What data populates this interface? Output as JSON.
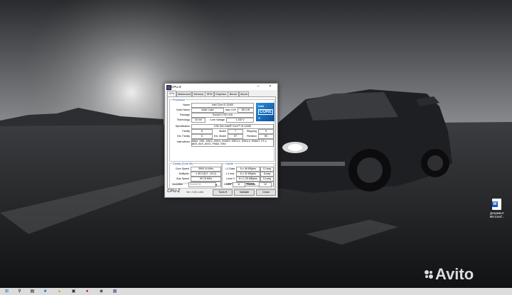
{
  "window": {
    "title": "CPU-Z",
    "tabs": [
      "CPU",
      "Mainboard",
      "Memory",
      "SPD",
      "Graphics",
      "Bench",
      "About"
    ],
    "active_tab": "CPU"
  },
  "processor": {
    "legend": "Processor",
    "name_label": "Name",
    "name": "Intel Core i5 12400",
    "codename_label": "Code Name",
    "codename": "Alder Lake",
    "maxtdp_label": "Max TDP",
    "maxtdp": "65.0 W",
    "package_label": "Package",
    "package": "Socket 1700 LGA",
    "technology_label": "Technology",
    "technology": "10 nm",
    "corevoltage_label": "Core Voltage",
    "corevoltage": "1.140 V",
    "specification_label": "Specification",
    "specification": "12th Gen Intel® Core™ i5-12400",
    "family_label": "Family",
    "family": "6",
    "model_label": "Model",
    "model": "7",
    "stepping_label": "Stepping",
    "stepping": "5",
    "extfamily_label": "Ext. Family",
    "extfamily": "6",
    "extmodel_label": "Ext. Model",
    "extmodel": "97",
    "revision_label": "Revision",
    "revision": "H0",
    "instructions_label": "Instructions",
    "instructions_line1": "MMX, SSE, SSE2, SSE3, SSSE3, SSE4.1, SSE4.2, EM64T, VT-x,",
    "instructions_line2": "AES, AVX, AVX2, FMA3, SHA",
    "logo_top": "intel",
    "logo_mid": "CORE",
    "logo_bot": "i5"
  },
  "clocks": {
    "legend": "Clocks (Core #0)",
    "corespeed_label": "Core Speed",
    "corespeed": "3990.24 MHz",
    "multiplier_label": "Multiplier",
    "multiplier": "x 40.0 (8.0 - 44.0)",
    "busspeed_label": "Bus Speed",
    "busspeed": "99.76 MHz",
    "ratedfsb_label": "Rated FSB"
  },
  "cache": {
    "legend": "Cache",
    "l1data_label": "L1 Data",
    "l1data": "6 x 48 KBytes",
    "l1data_way": "12-way",
    "l1inst_label": "L1 Inst.",
    "l1inst": "6 x 32 KBytes",
    "l1inst_way": "8-way",
    "level2_label": "Level 2",
    "level2": "6 x 1.25 MBytes",
    "level2_way": "10-way",
    "level3_label": "Level 3",
    "level3": "18 MBytes",
    "level3_way": "12-way"
  },
  "selection": {
    "selection_label": "Selection",
    "selection_value": "Socket #1",
    "cores_label": "Cores",
    "cores": "6",
    "threads_label": "Threads",
    "threads": "12"
  },
  "bottom": {
    "brand": "CPU-Z",
    "version": "Ver. 2.05.1.x64",
    "tools": "Tools",
    "validate": "Validate",
    "close": "Close"
  },
  "desktop_icon": {
    "label_line1": "Документ",
    "label_line2": "Microsof..."
  },
  "watermark": "Avito",
  "colors": {
    "accent": "#003399",
    "intel_blue": "#0b4f9e",
    "word_blue": "#185abd"
  }
}
